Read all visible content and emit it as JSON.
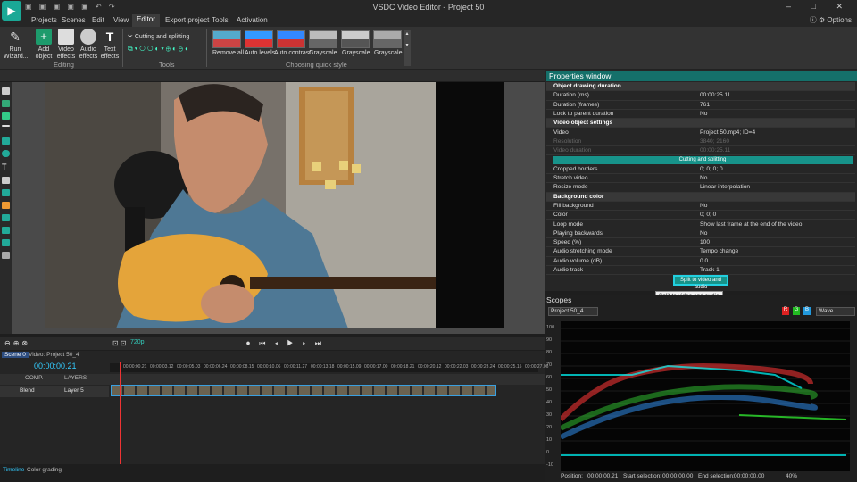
{
  "window": {
    "title": "VSDC Video Editor - Project 50"
  },
  "menu": {
    "items": [
      "Projects",
      "Scenes",
      "Edit",
      "View",
      "Editor",
      "Export project",
      "Tools",
      "Activation"
    ],
    "active": "Editor",
    "options": "Options"
  },
  "ribbon": {
    "run": "Run\nWizard...",
    "add_object": "Add\nobject",
    "video_effects": "Video\neffects",
    "audio_effects": "Audio\neffects",
    "text_effects": "Text\neffects",
    "editing": "Editing",
    "cutting": "Cutting and splitting",
    "tools": "Tools",
    "quick": [
      "Remove all",
      "Auto levels",
      "Auto contrast",
      "Grayscale",
      "Grayscale",
      "Grayscale"
    ],
    "quick_label": "Choosing quick style"
  },
  "properties": {
    "title": "Properties window",
    "rows": [
      {
        "k": "Object drawing duration",
        "v": "",
        "t": "sec"
      },
      {
        "k": "Duration (ms)",
        "v": "00:00:25.11",
        "t": ""
      },
      {
        "k": "Duration (frames)",
        "v": "761",
        "t": ""
      },
      {
        "k": "Lock to parent duration",
        "v": "No",
        "t": ""
      },
      {
        "k": "Video object settings",
        "v": "",
        "t": "sec"
      },
      {
        "k": "Video",
        "v": "Project 50.mp4; ID=4",
        "t": ""
      },
      {
        "k": "Resolution",
        "v": "3840; 2160",
        "t": "dim"
      },
      {
        "k": "Video duration",
        "v": "00:00:25.11",
        "t": "dim"
      },
      {
        "k": "Cutting and splitting",
        "v": "",
        "t": "bar"
      },
      {
        "k": "Cropped borders",
        "v": "0; 0; 0; 0",
        "t": ""
      },
      {
        "k": "Stretch video",
        "v": "No",
        "t": ""
      },
      {
        "k": "Resize mode",
        "v": "Linear interpolation",
        "t": ""
      },
      {
        "k": "Background color",
        "v": "",
        "t": "sec"
      },
      {
        "k": "Fill background",
        "v": "No",
        "t": ""
      },
      {
        "k": "Color",
        "v": "0; 0; 0",
        "t": ""
      },
      {
        "k": "Loop mode",
        "v": "Show last frame at the end of the video",
        "t": ""
      },
      {
        "k": "Playing backwards",
        "v": "No",
        "t": ""
      },
      {
        "k": "Speed (%)",
        "v": "100",
        "t": ""
      },
      {
        "k": "Audio stretching mode",
        "v": "Tempo change",
        "t": ""
      },
      {
        "k": "Audio volume (dB)",
        "v": "0.0",
        "t": ""
      },
      {
        "k": "Audio track",
        "v": "Track 1",
        "t": ""
      }
    ],
    "split_button": "Split to video and audio",
    "tooltip": "Split to video and audio"
  },
  "scopes": {
    "title": "Scopes",
    "source": "Project 50_4",
    "mode": "Wave",
    "r": "R",
    "g": "G",
    "b": "B",
    "yticks": [
      "100",
      "90",
      "80",
      "70",
      "60",
      "50",
      "40",
      "30",
      "20",
      "10",
      "0",
      "-10"
    ]
  },
  "status": {
    "position": "Position:",
    "pos_val": "00:00:00.21",
    "start_sel": "Start selection:",
    "start_val": "00:00:00.00",
    "end_sel": "End selection:",
    "end_val": "00:00:00.00",
    "zoom": "40%"
  },
  "timeline": {
    "scene_tab": "Scene 0",
    "video_tab": "Video: Project 50_4",
    "time": "00:00:00.21",
    "quality": "720p",
    "ruler": [
      "00:00:00.21",
      "00:00:03.12",
      "00:00:05.03",
      "00:00:06.24",
      "00:00:08.15",
      "00:00:10.06",
      "00:00:11.27",
      "00:00:13.18",
      "00:00:15.09",
      "00:00:17.00",
      "00:00:18.21",
      "00:00:20.12",
      "00:00:22.03",
      "00:00:23.24",
      "00:00:25.15",
      "00:00:27.06"
    ],
    "comp": "COMP.",
    "layers": "LAYERS",
    "blend": "Blend",
    "layer": "Layer 5"
  },
  "bottom_tabs": [
    "Timeline",
    "Color grading"
  ]
}
